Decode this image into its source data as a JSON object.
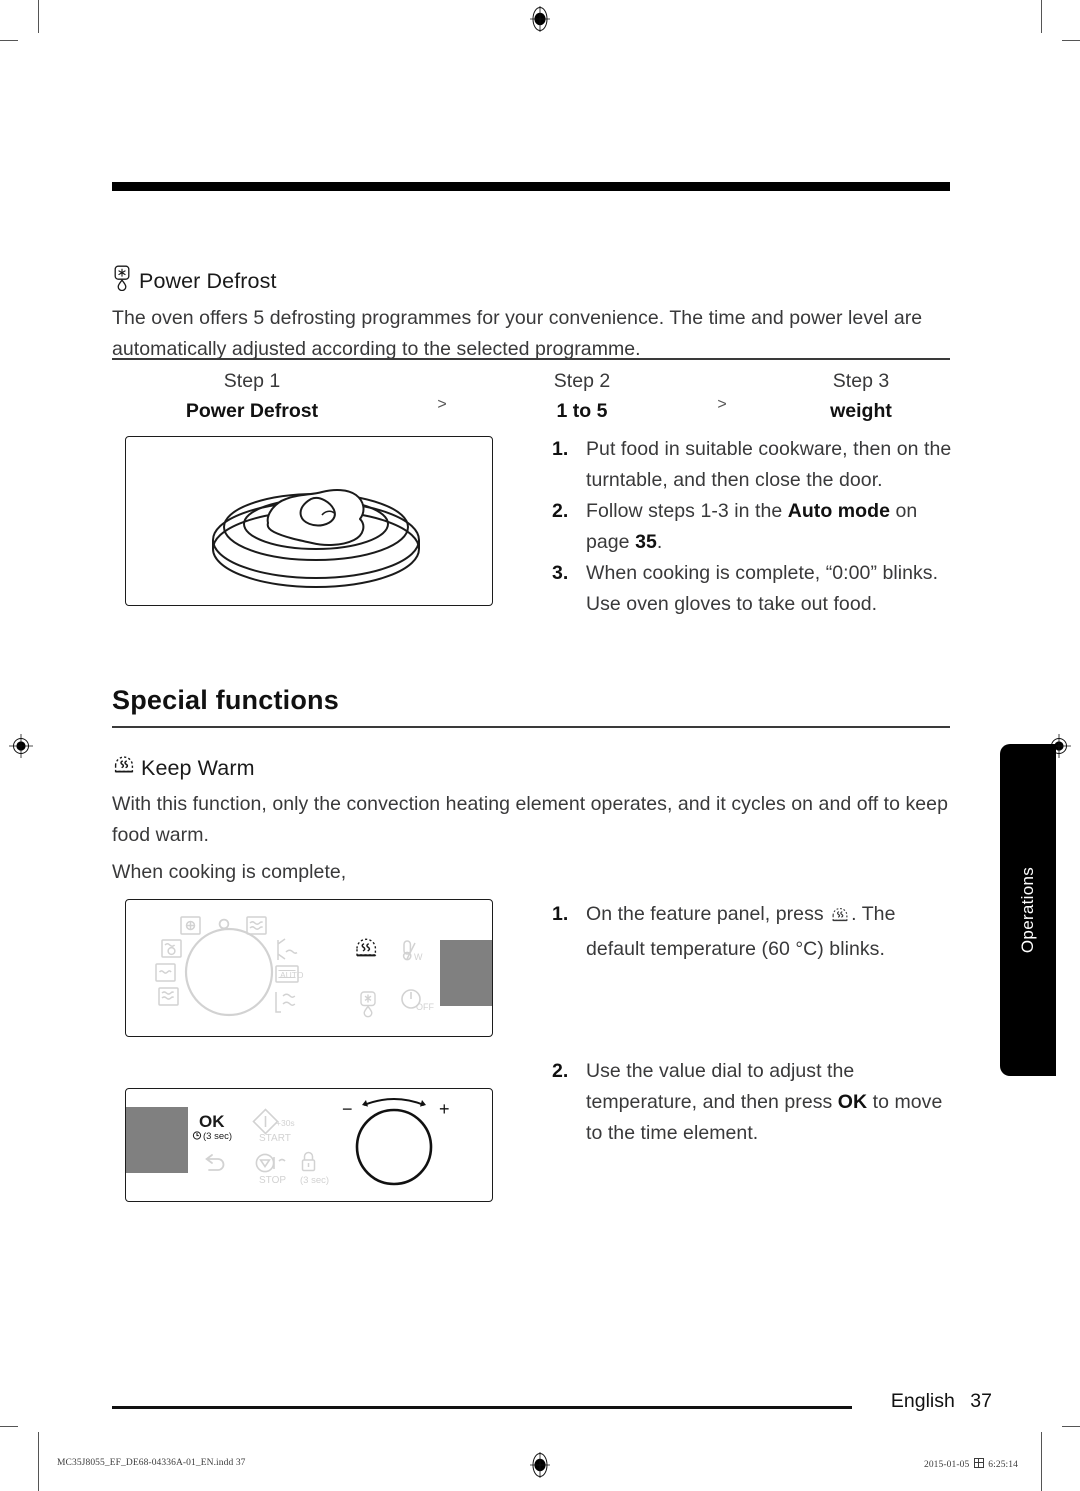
{
  "document": {
    "page_number": "37",
    "language_label": "English",
    "side_tab_label": "Operations",
    "imprint_file": "MC35J8055_EF_DE68-04336A-01_EN.indd   37",
    "imprint_page": "37",
    "imprint_date": "2015-01-05",
    "imprint_time": "6:25:14"
  },
  "power_defrost": {
    "icon": "snowflake-droplet-icon",
    "heading": "Power Defrost",
    "intro": "The oven offers 5 defrosting programmes for your convenience. The time and power level are automatically adjusted according to the selected programme.",
    "table": {
      "arrow": ">",
      "columns": [
        {
          "label": "Step 1",
          "value": "Power Defrost"
        },
        {
          "label": "Step 2",
          "value": "1 to 5"
        },
        {
          "label": "Step 3",
          "value": "weight"
        }
      ]
    },
    "figure": "turntable-with-meat-on-plate-illustration",
    "steps": [
      {
        "num": "1.",
        "text": "Put food in suitable cookware, then on the turntable, and then close the door."
      },
      {
        "num": "2.",
        "text_before": "Follow steps 1-3 in the ",
        "bold": "Auto mode",
        "text_mid": " on page ",
        "bold2": "35",
        "text_after": "."
      },
      {
        "num": "3.",
        "text": "When cooking is complete, “0:00” blinks. Use oven gloves to take out food."
      }
    ]
  },
  "special_functions": {
    "title": "Special functions",
    "keep_warm": {
      "icon": "keep-warm-icon",
      "heading": "Keep Warm",
      "intro": "With this function, only the convection heating element operates, and it cycles on and off to keep food warm.",
      "lead_in": "When cooking is complete,",
      "steps": [
        {
          "num": "1.",
          "text_before": "On the feature panel, press ",
          "icon": "keep-warm-icon",
          "text_after": ". The default temperature (60 °C) blinks."
        },
        {
          "num": "2.",
          "text_before": "Use the value dial to adjust the temperature, and then press ",
          "bold": "OK",
          "text_after": " to move to the time element."
        }
      ]
    }
  },
  "feature_panel": {
    "mode_dial_label": "mode-dial",
    "mode_icons": [
      "convection-fan-icon",
      "microwave-waves-icon",
      "grill-fan-icon",
      "grill-microwave-combi-icon",
      "slim-fry-icon",
      "steam-clean-icon",
      "lower-grill-icon",
      "auto-icon",
      "defrost-air-icon"
    ],
    "keep_warm_button": "keep-warm-icon",
    "power_level_button": "temperature-watt-icon",
    "power_defrost_button": "snowflake-droplet-icon",
    "off_button": "off-icon",
    "off_label": "OFF"
  },
  "value_panel": {
    "ok_label": "OK",
    "ok_sub": "(3 sec)",
    "start_label": "START",
    "start_sub": "+30s",
    "stop_label": "STOP",
    "lock_sub": "(3 sec)",
    "back_icon": "back-arrow-icon",
    "dial_minus": "−",
    "dial_plus": "+",
    "dial_label": "value-dial"
  },
  "colors": {
    "rule": "#000000",
    "body_text": "#39393a",
    "heading_text": "#111111",
    "tab_background": "#000000",
    "panel_gray": "#808080",
    "panel_icon_gray": "#d0d0d0"
  }
}
